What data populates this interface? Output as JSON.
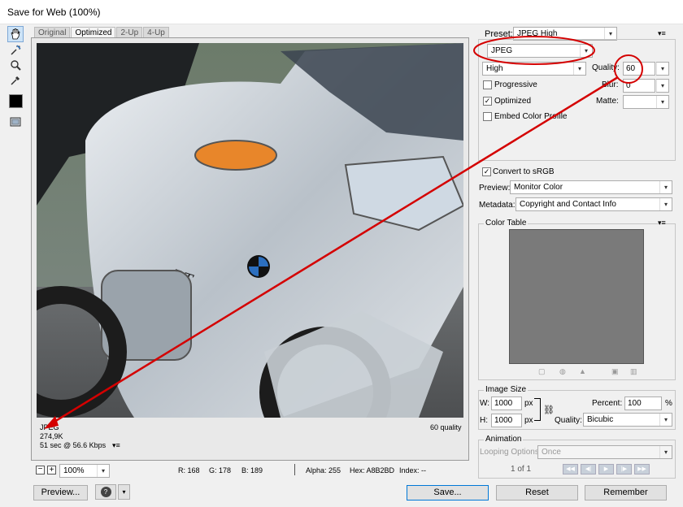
{
  "window": {
    "title": "Save for Web (100%)"
  },
  "tools": [
    "hand-tool",
    "slice-select-tool",
    "zoom-tool",
    "eyedropper-tool"
  ],
  "tabs": [
    {
      "label": "Original"
    },
    {
      "label": "Optimized"
    },
    {
      "label": "2-Up"
    },
    {
      "label": "4-Up"
    }
  ],
  "image_info": {
    "format": "JPEG",
    "size": "274,9K",
    "time": "51 sec @ 56.6 Kbps",
    "quality": "60 quality"
  },
  "settings": {
    "preset_label": "Preset:",
    "preset_value": "JPEG High",
    "format_value": "JPEG",
    "compression_value": "High",
    "quality_label": "Quality:",
    "quality_value": "60",
    "progressive_label": "Progressive",
    "blur_label": "Blur:",
    "blur_value": "0",
    "optimized_label": "Optimized",
    "matte_label": "Matte:",
    "embed_profile_label": "Embed Color Profile",
    "convert_label": "Convert to sRGB",
    "preview_label": "Preview:",
    "preview_value": "Monitor Color",
    "metadata_label": "Metadata:",
    "metadata_value": "Copyright and Contact Info"
  },
  "color_table": {
    "title": "Color Table"
  },
  "image_size": {
    "title": "Image Size",
    "w_label": "W:",
    "w_value": "1000",
    "h_label": "H:",
    "h_value": "1000",
    "unit": "px",
    "percent_label": "Percent:",
    "percent_value": "100",
    "percent_unit": "%",
    "quality_label": "Quality:",
    "quality_value": "Bicubic"
  },
  "animation": {
    "title": "Animation",
    "looping_label": "Looping Options:",
    "looping_value": "Once",
    "frame_counter": "1 of 1"
  },
  "status_bar": {
    "zoom": "100%",
    "r": "R: 168",
    "g": "G: 178",
    "b": "B: 189",
    "alpha": "Alpha: 255",
    "hex": "Hex: A8B2BD",
    "index": "Index: --"
  },
  "buttons": {
    "preview": "Preview...",
    "save": "Save...",
    "reset": "Reset",
    "remember": "Remember"
  },
  "colors": {
    "annotation": "#d40000",
    "selection": "#cde3f7"
  }
}
